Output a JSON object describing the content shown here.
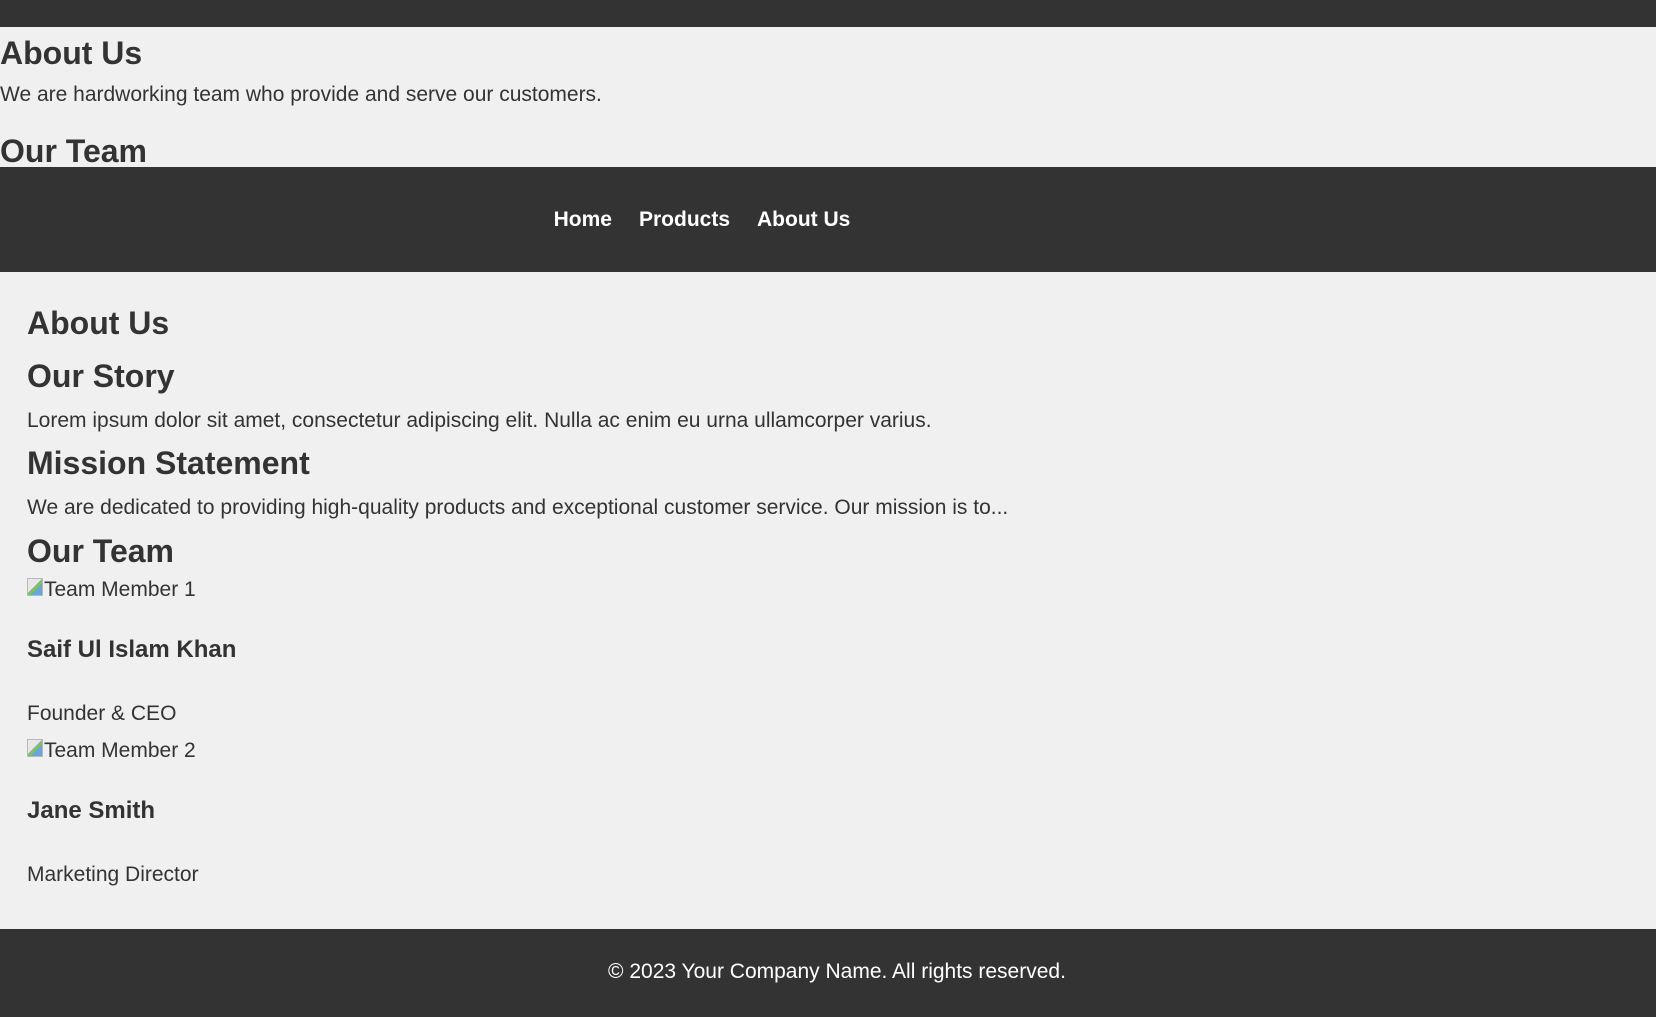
{
  "top": {
    "title": "About Us",
    "text": "We are hardworking team who provide and serve our customers.",
    "team_heading": "Our Team"
  },
  "nav": {
    "items": [
      {
        "label": "Home"
      },
      {
        "label": "Products"
      },
      {
        "label": "About Us"
      }
    ]
  },
  "main": {
    "title": "About Us",
    "story_heading": "Our Story",
    "story_text": "Lorem ipsum dolor sit amet, consectetur adipiscing elit. Nulla ac enim eu urna ullamcorper varius.",
    "mission_heading": "Mission Statement",
    "mission_text": "We are dedicated to providing high-quality products and exceptional customer service. Our mission is to...",
    "team_heading": "Our Team",
    "team": [
      {
        "image_alt": "Team Member 1",
        "name": "Saif Ul Islam Khan",
        "role": "Founder & CEO"
      },
      {
        "image_alt": "Team Member 2",
        "name": "Jane Smith",
        "role": "Marketing Director"
      }
    ]
  },
  "footer": {
    "text": "© 2023 Your Company Name. All rights reserved."
  },
  "colors": {
    "dark": "#333333",
    "background": "#f0f0f0",
    "text": "#333333",
    "light_text": "#ffffff"
  }
}
